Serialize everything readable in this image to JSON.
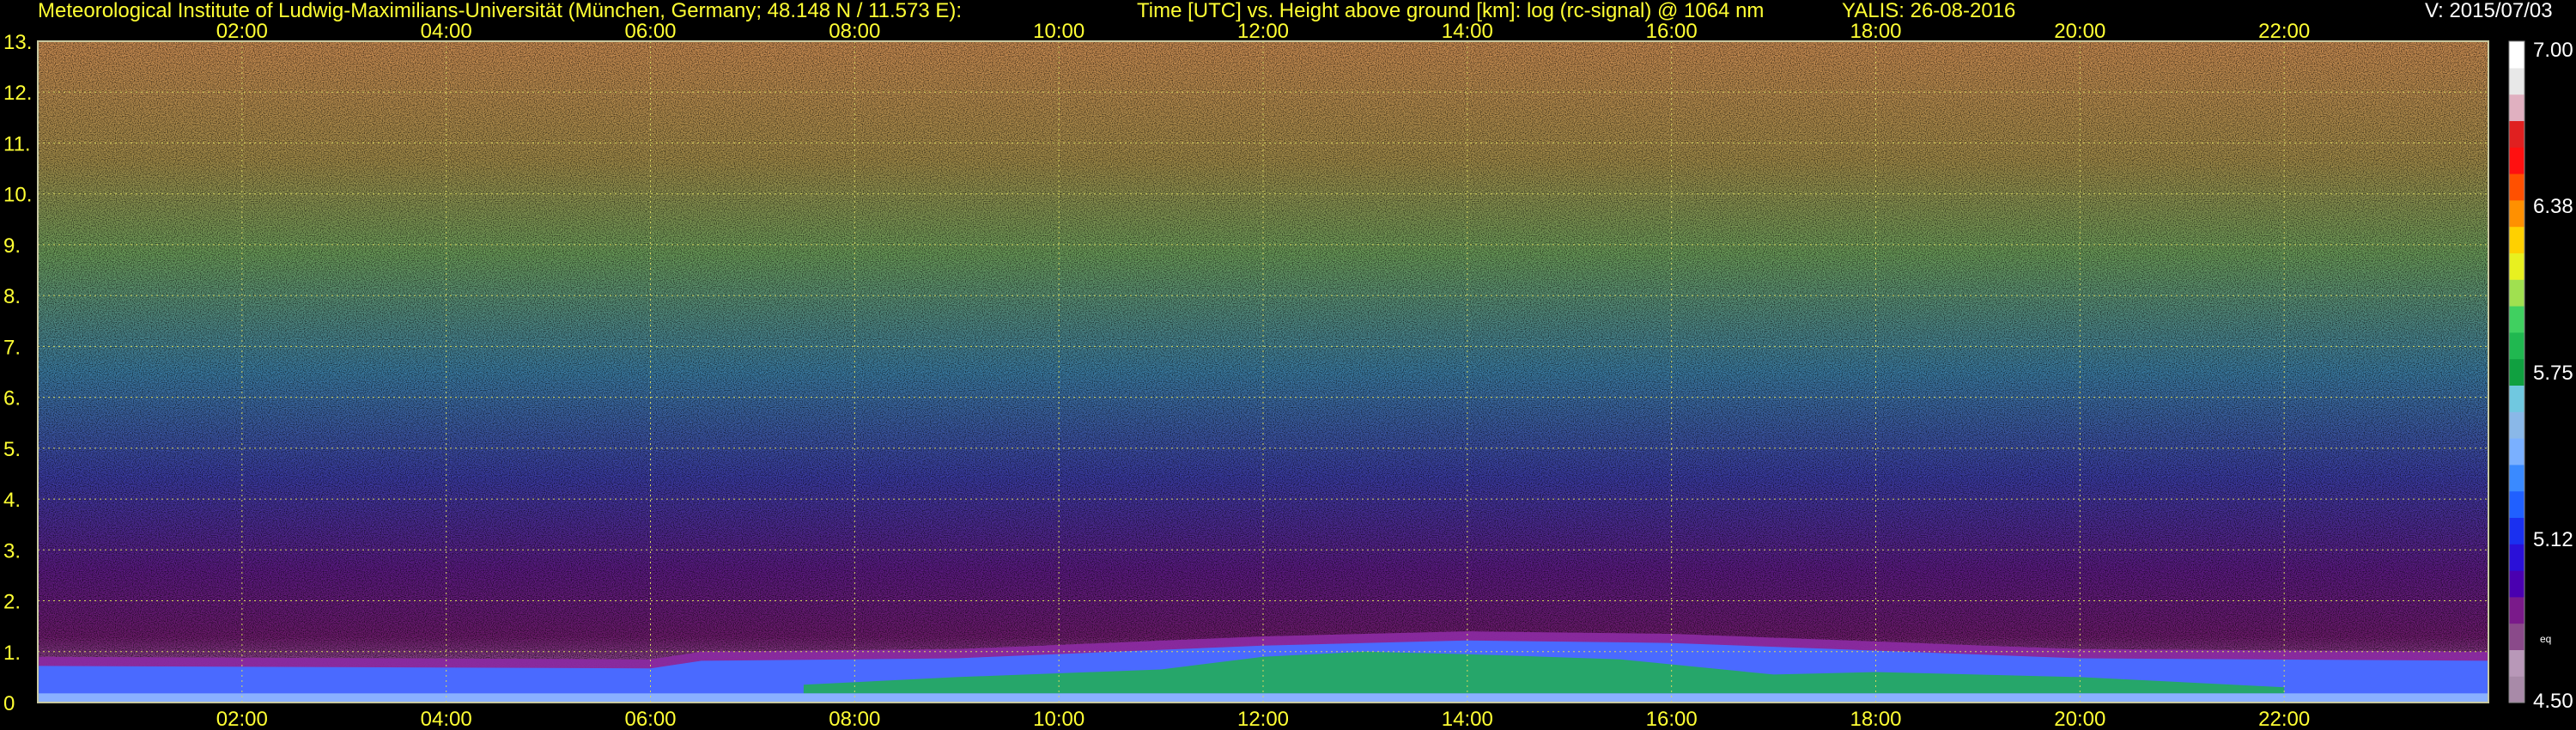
{
  "header": {
    "institute": "Meteorological Institute of Ludwig-Maximilians-Universität (München, Germany; 48.148 N / 11.573 E):",
    "description": "Time [UTC] vs. Height above ground [km]: log (rc-signal) @ 1064 nm",
    "instrument_date": "YALIS: 26-08-2016",
    "version": "V: 2015/07/03"
  },
  "colors": {
    "text_yellow": "#ffff33",
    "grid_yellow": "#d8d860",
    "background": "#000000"
  },
  "chart_data": {
    "type": "heatmap",
    "title": "Time [UTC] vs. Height above ground [km]: log (rc-signal) @ 1064 nm",
    "x_tick_labels": [
      "02:00",
      "04:00",
      "06:00",
      "08:00",
      "10:00",
      "12:00",
      "14:00",
      "16:00",
      "18:00",
      "20:00",
      "22:00"
    ],
    "x_ticks_hours": [
      2,
      4,
      6,
      8,
      10,
      12,
      14,
      16,
      18,
      20,
      22
    ],
    "xlim_hours": [
      0,
      24
    ],
    "y_tick_labels": [
      "0",
      "1.",
      "2.",
      "3.",
      "4.",
      "5.",
      "6.",
      "7.",
      "8.",
      "9.",
      "10.",
      "11.",
      "12.",
      "13."
    ],
    "y_ticks_km": [
      0,
      1,
      2,
      3,
      4,
      5,
      6,
      7,
      8,
      9,
      10,
      11,
      12,
      13
    ],
    "ylim_km": [
      0,
      13
    ],
    "grid": true,
    "colorbar": {
      "range": [
        4.5,
        7.0
      ],
      "tick_labels": [
        "7.00",
        "6.38",
        "5.75",
        "5.12",
        "4.50"
      ],
      "tick_values": [
        7.0,
        6.38,
        5.75,
        5.12,
        4.5
      ],
      "extra_label": "eq",
      "colors": [
        "#a88aa8",
        "#b898b8",
        "#8a4a8a",
        "#7a1a8a",
        "#4a00b0",
        "#2a10d8",
        "#1a30f0",
        "#2060ff",
        "#3a8aff",
        "#7ab0ff",
        "#8ab8e8",
        "#70c8e0",
        "#10a040",
        "#20b850",
        "#40d060",
        "#a0e050",
        "#e8f020",
        "#ffd000",
        "#ff9000",
        "#ff5000",
        "#ff1010",
        "#e02020",
        "#e0b0c0",
        "#e8e8e8",
        "#ffffff"
      ]
    },
    "boundary_layer_top_km": [
      {
        "time": 0,
        "height": 0.9
      },
      {
        "time": 6,
        "height": 0.85
      },
      {
        "time": 6.5,
        "height": 1.0
      },
      {
        "time": 9,
        "height": 1.05
      },
      {
        "time": 12,
        "height": 1.3
      },
      {
        "time": 14,
        "height": 1.4
      },
      {
        "time": 16,
        "height": 1.35
      },
      {
        "time": 18,
        "height": 1.2
      },
      {
        "time": 20,
        "height": 1.05
      },
      {
        "time": 24,
        "height": 1.0
      }
    ]
  }
}
